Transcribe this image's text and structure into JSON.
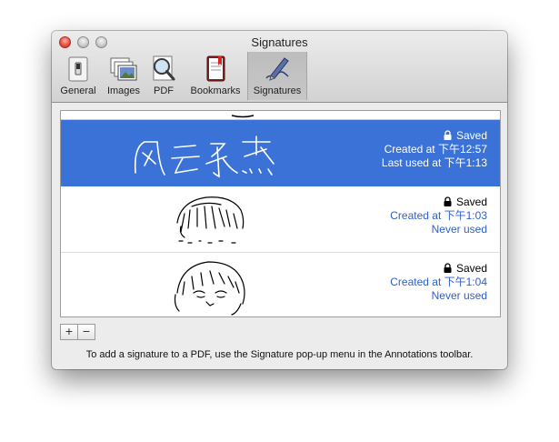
{
  "window": {
    "title": "Signatures"
  },
  "toolbar": [
    {
      "label": "General",
      "icon": "general-switch-icon",
      "selected": false
    },
    {
      "label": "Images",
      "icon": "images-icon",
      "selected": false
    },
    {
      "label": "PDF",
      "icon": "pdf-magnifier-icon",
      "selected": false
    },
    {
      "label": "Bookmarks",
      "icon": "bookmarks-icon",
      "selected": false
    },
    {
      "label": "Signatures",
      "icon": "signatures-pen-icon",
      "selected": true
    }
  ],
  "signatures": [
    {
      "status": "Saved",
      "created": "Created at 下午12:57",
      "used": "Last used at 下午1:13",
      "selected": true,
      "kind": "handwritten-chinese"
    },
    {
      "status": "Saved",
      "created": "Created at 下午1:03",
      "used": "Never used",
      "selected": false,
      "kind": "sketch-hair"
    },
    {
      "status": "Saved",
      "created": "Created at 下午1:04",
      "used": "Never used",
      "selected": false,
      "kind": "sketch-face"
    }
  ],
  "buttons": {
    "add": "+",
    "remove": "−"
  },
  "footer": {
    "text": "To add a signature to a PDF, use the Signature pop-up menu in the Annotations toolbar."
  },
  "colors": {
    "selection": "#3a72d7",
    "link_text": "#2f5fc9"
  }
}
